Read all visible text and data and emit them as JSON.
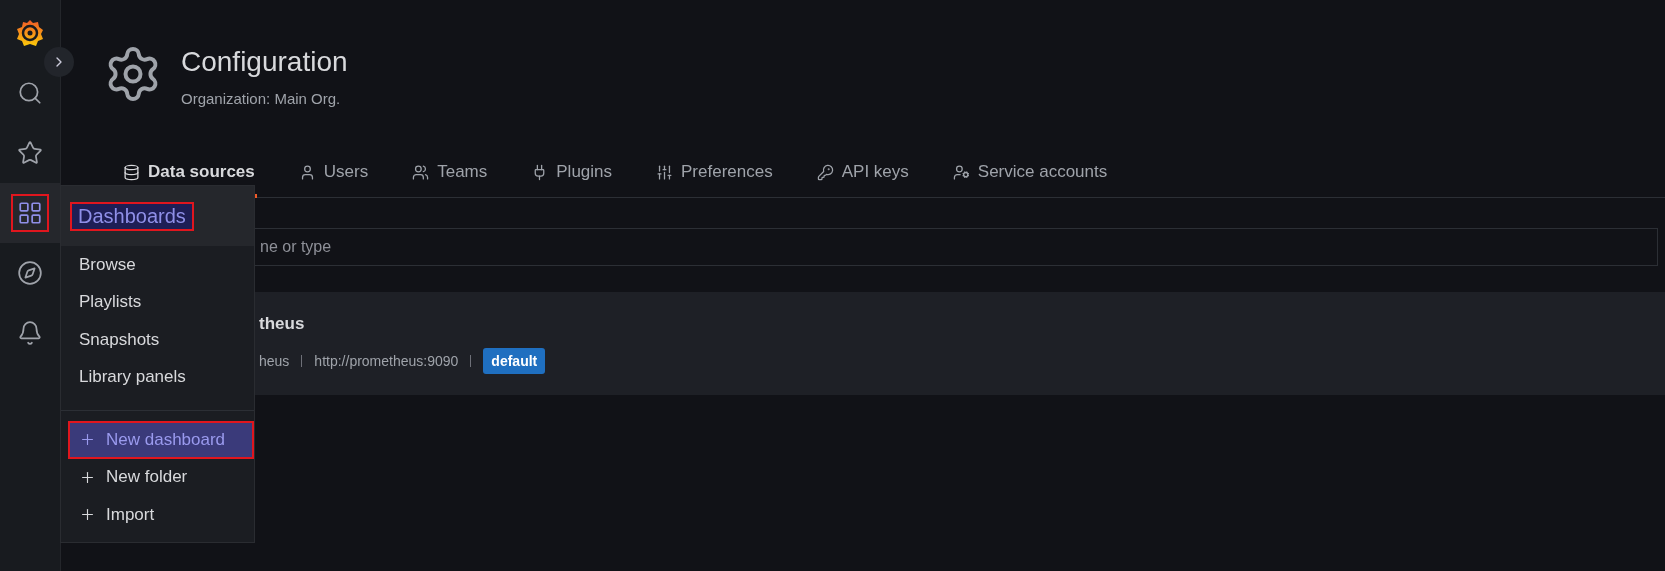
{
  "sidebar": {
    "items": [
      {
        "selected": false
      },
      {
        "selected": false
      },
      {
        "selected": true
      },
      {
        "selected": false
      },
      {
        "selected": false
      }
    ]
  },
  "header": {
    "title": "Configuration",
    "subtitle": "Organization: Main Org."
  },
  "tabs": [
    {
      "label": "Data sources",
      "selected": true
    },
    {
      "label": "Users",
      "selected": false
    },
    {
      "label": "Teams",
      "selected": false
    },
    {
      "label": "Plugins",
      "selected": false
    },
    {
      "label": "Preferences",
      "selected": false
    },
    {
      "label": "API keys",
      "selected": false
    },
    {
      "label": "Service accounts",
      "selected": false
    }
  ],
  "search": {
    "placeholder": "ne or type"
  },
  "datasource": {
    "name": "theus",
    "type": "heus",
    "url": "http://prometheus:9090",
    "badge": "default"
  },
  "menu": {
    "title": "Dashboards",
    "items": [
      {
        "kind": "link",
        "label": "Browse",
        "selected": false
      },
      {
        "kind": "link",
        "label": "Playlists",
        "selected": false
      },
      {
        "kind": "link",
        "label": "Snapshots",
        "selected": false
      },
      {
        "kind": "link",
        "label": "Library panels",
        "selected": false
      },
      {
        "kind": "action",
        "label": "New dashboard",
        "selected": true
      },
      {
        "kind": "action",
        "label": "New folder",
        "selected": false
      },
      {
        "kind": "action",
        "label": "Import",
        "selected": false
      }
    ]
  }
}
